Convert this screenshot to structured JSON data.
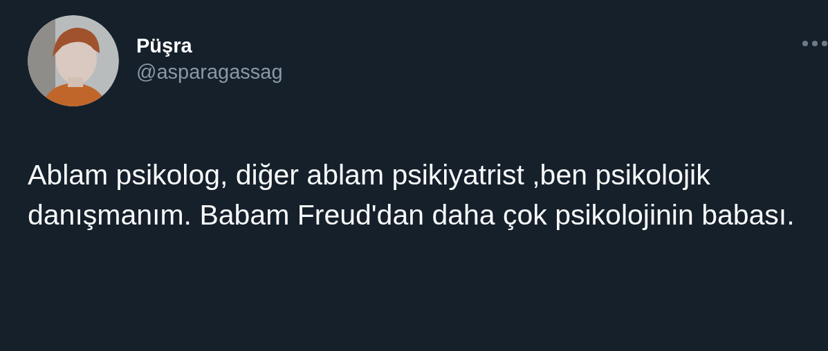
{
  "author": {
    "name": "Püşra",
    "handle": "@asparagassag"
  },
  "tweet": {
    "text": "Ablam psikolog, diğer ablam psikiyatrist ,ben psikolojik danışmanım. Babam Freud'dan daha çok psikolojinin babası."
  }
}
